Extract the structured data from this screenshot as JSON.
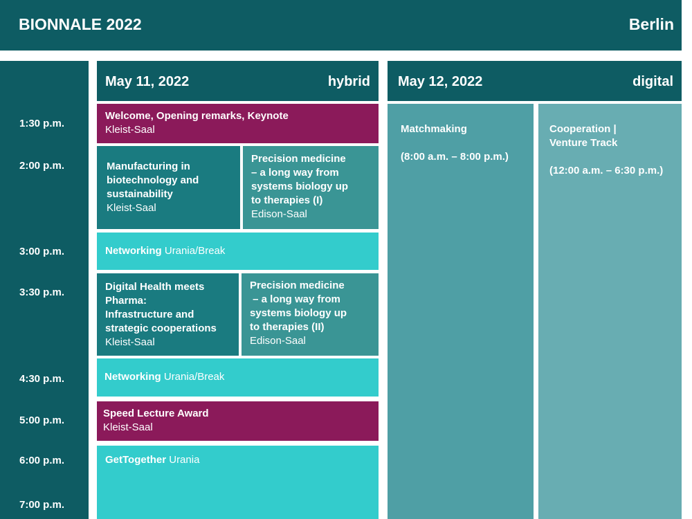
{
  "header": {
    "title": "BIONNALE 2022",
    "city": "Berlin"
  },
  "times": [
    "1:30 p.m.",
    "2:00 p.m.",
    "3:00 p.m.",
    "3:30 p.m.",
    "4:30 p.m.",
    "5:00 p.m.",
    "6:00 p.m.",
    "7:00 p.m."
  ],
  "day1": {
    "date": "May 11, 2022",
    "mode": "hybrid",
    "welcome": {
      "title": "Welcome, Opening remarks, Keynote",
      "room": "Kleist-Saal"
    },
    "manufacturing": {
      "title_lines": [
        "Manufacturing in",
        "biotechnology and",
        "sustainability"
      ],
      "room": "Kleist-Saal"
    },
    "precision1": {
      "title_lines": [
        "Precision medicine",
        "– a long way from",
        "systems biology up",
        "to therapies (I)"
      ],
      "room": "Edison-Saal"
    },
    "networking1": {
      "title": "Networking",
      "place": "Urania/Break"
    },
    "digital_health": {
      "title_lines": [
        "Digital Health meets",
        "Pharma:",
        "Infrastructure and",
        "strategic cooperations"
      ],
      "room": "Kleist-Saal"
    },
    "precision2": {
      "title_lines": [
        "Precision medicine",
        " – a long way from",
        "systems biology up",
        "to therapies (II)"
      ],
      "room": "Edison-Saal"
    },
    "networking2": {
      "title": "Networking",
      "place": "Urania/Break"
    },
    "speed": {
      "title": "Speed Lecture Award",
      "room": "Kleist-Saal"
    },
    "gettogether": {
      "title": "GetTogether",
      "place": "Urania"
    }
  },
  "day2": {
    "date": "May 12, 2022",
    "mode": "digital",
    "matchmaking": {
      "title": "Matchmaking",
      "hours": "(8:00 a.m. – 8:00 p.m.)"
    },
    "cooperation": {
      "title_lines": [
        "Cooperation |",
        "Venture Track"
      ],
      "hours": "(12:00 a.m. – 6:30 p.m.)"
    }
  },
  "colors": {
    "dark_teal": "#0e5c63",
    "magenta": "#8b1a5a",
    "teal": "#1a7b80",
    "cyan": "#33cccc",
    "digital_a": "#4f9fa5",
    "digital_b": "#68adb2"
  }
}
